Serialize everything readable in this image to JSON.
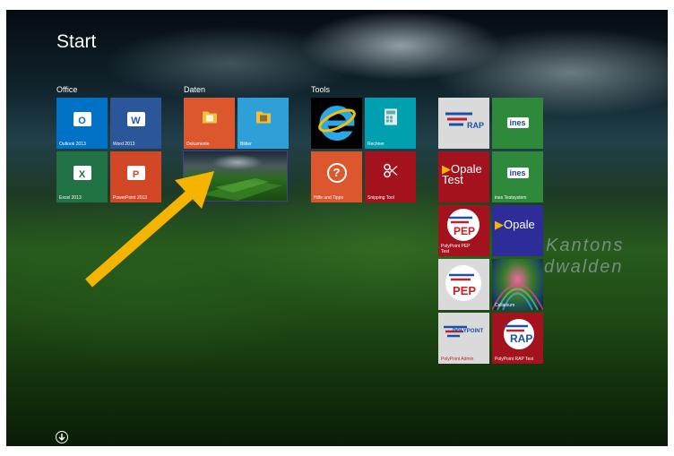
{
  "title": "Start",
  "groups": {
    "office": "Office",
    "daten": "Daten",
    "tools": "Tools"
  },
  "tiles": {
    "outlook": "Outlook 2013",
    "word": "Word 2013",
    "excel": "Excel 2013",
    "powerpoint": "PowerPoint 2013",
    "dokumente": "Dokumente",
    "bilder": "Bilder",
    "rechner": "Rechner",
    "hilfe": "Hilfe und Tipps",
    "snipping": "Snipping Tool",
    "ines_testsystem": "ines Testsystem",
    "pep_test": "PolyPoint PEP Test",
    "cellanium": "Cellanium",
    "polypoint_admin": "PolyPoint Admin",
    "rap_test": "PolyPoint RAP Test"
  },
  "logos": {
    "outlook": "O",
    "word": "W",
    "excel": "X",
    "powerpoint": "P",
    "rap": "RAP",
    "ines": "ines",
    "opale_test": "Opale Test",
    "opale": "Opale",
    "pep": "PEP",
    "polypoint": "POLYPOINT",
    "help": "?"
  },
  "watermark": {
    "line1": "Kantons",
    "line2": "dwalden"
  },
  "colors": {
    "outlook": "#0072c6",
    "word": "#2b579a",
    "excel": "#217346",
    "powerpoint": "#d24726",
    "orange": "#dc572e",
    "lightblue": "#2f9fd8",
    "teal": "#00a0b0",
    "darkred": "#a4121e",
    "green": "#2e8a3a",
    "navy": "#2d2d9a",
    "arrow": "#f5b400"
  },
  "icons": {
    "outlook": "outlook-icon",
    "word": "word-icon",
    "excel": "excel-icon",
    "powerpoint": "powerpoint-icon",
    "dokumente": "folder-icon",
    "bilder": "pictures-folder-icon",
    "ie": "internet-explorer-icon",
    "rechner": "calculator-icon",
    "hilfe": "help-icon",
    "snipping": "scissors-icon",
    "all_apps": "down-arrow-circle-icon"
  }
}
